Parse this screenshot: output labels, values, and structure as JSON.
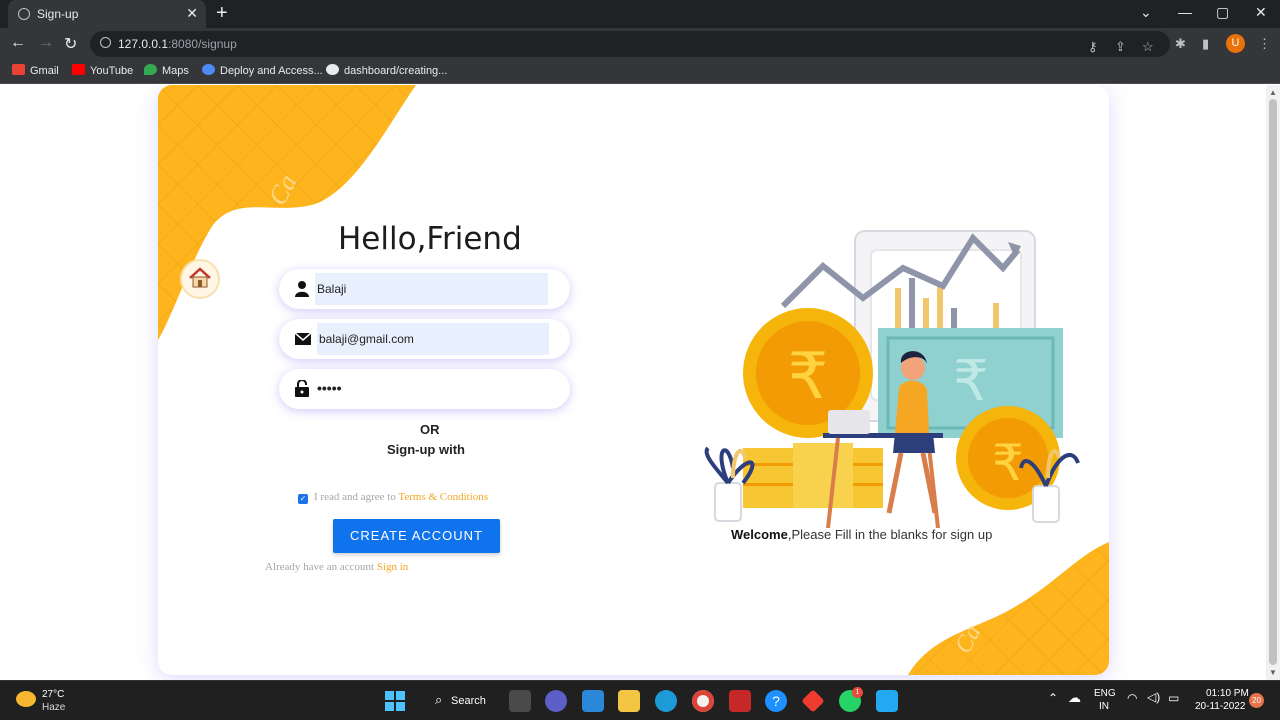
{
  "browser": {
    "tab_title": "Sign-up",
    "url_host": "127.0.0.1",
    "url_path": ":8080/signup",
    "profile_initial": "U",
    "bookmarks": [
      "Gmail",
      "YouTube",
      "Maps",
      "Deploy and Access...",
      "dashboard/creating..."
    ]
  },
  "page": {
    "heading": "Hello,Friend",
    "name_value": "Balaji",
    "email_value": "balaji@gmail.com",
    "password_mask": "•••••",
    "or_text": "OR",
    "signup_with": "Sign-up with",
    "agree_text": "I read and agree to ",
    "terms_link": "Terms & Conditions",
    "create_button": "CREATE ACCOUNT",
    "have_account_text": "Already have an account ",
    "signin_link": "Sign in",
    "welcome_bold": "Welcome",
    "welcome_text": ",Please Fill in the blanks for sign up",
    "accent_color": "#fdb41d",
    "button_color": "#0f73ee",
    "link_color": "#f5a623"
  },
  "taskbar": {
    "temperature": "27°C",
    "weather": "Haze",
    "search_label": "Search",
    "lang1": "ENG",
    "lang2": "IN",
    "time": "01:10 PM",
    "date": "20-11-2022",
    "notifications": "20",
    "whatsapp_badge": "1"
  }
}
